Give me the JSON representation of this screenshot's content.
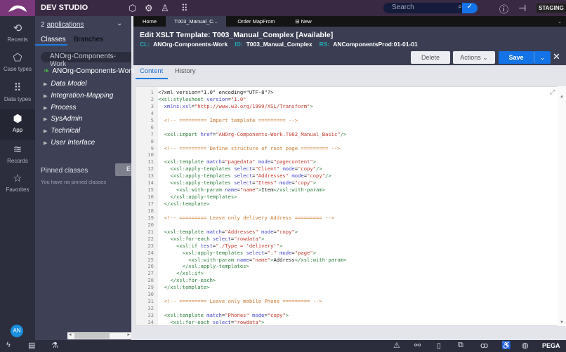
{
  "topbar": {
    "studio": "DEV STUDIO",
    "search_placeholder": "Search",
    "env": "STAGING",
    "icons": [
      "cube-icon",
      "gear-icon",
      "rocket-icon",
      "grid-icon"
    ]
  },
  "rail": [
    {
      "label": "Recents",
      "icon": "⟲"
    },
    {
      "label": "Case types",
      "icon": "⬠"
    },
    {
      "label": "Data types",
      "icon": "⠿"
    },
    {
      "label": "App",
      "icon": "⬢"
    },
    {
      "label": "Records",
      "icon": "≋"
    },
    {
      "label": "Favorites",
      "icon": "☆"
    }
  ],
  "user": {
    "initials": "AN"
  },
  "sidebar": {
    "app_count": "2",
    "apps_link": "applications",
    "tabs": [
      "Classes",
      "Branches"
    ],
    "class_field": "ANOrg-Components-Work",
    "root": "ANOrg-Components-Work",
    "nodes": [
      "Data Model",
      "Integration-Mapping",
      "Process",
      "SysAdmin",
      "Technical",
      "User Interface"
    ],
    "pinned_title": "Pinned classes",
    "pinned_empty": "You have no pinned classes",
    "pinned_btn": "E"
  },
  "tabs": [
    "Home",
    "T003_Manual_C...",
    "Order MapFrom",
    "New"
  ],
  "header": {
    "title": "Edit  XSLT Template: T003_Manual_Complex [Available]",
    "cl_key": "CL:",
    "cl": "ANOrg-Components-Work",
    "id_key": "ID:",
    "id": "T003_Manual_Complex",
    "rs_key": "RS:",
    "rs": "ANComponentsProd:01-01-01",
    "delete": "Delete",
    "actions": "Actions",
    "save": "Save"
  },
  "content_tabs": [
    "Content",
    "History"
  ],
  "code": [
    [
      [
        "txt",
        "<?xml version=\"1.0\" encoding=\"UTF-8\"?>"
      ]
    ],
    [
      [
        "tag",
        "<xsl:stylesheet "
      ],
      [
        "attr",
        "version"
      ],
      [
        "txt",
        "="
      ],
      [
        "str",
        "\"1.0\""
      ]
    ],
    [
      [
        "txt",
        "  "
      ],
      [
        "attr",
        "xmlns:xsl"
      ],
      [
        "txt",
        "="
      ],
      [
        "str",
        "\"http://www.w3.org/1999/XSL/Transform\""
      ],
      [
        "tag",
        ">"
      ]
    ],
    [],
    [
      [
        "com",
        "  <!-- ========= Import template ========= -->"
      ]
    ],
    [],
    [
      [
        "tag",
        "  <xsl:import "
      ],
      [
        "attr",
        "href"
      ],
      [
        "txt",
        "="
      ],
      [
        "str",
        "\"ANOrg-Components-Work.T002_Manual_Basic\""
      ],
      [
        "tag",
        "/>"
      ]
    ],
    [],
    [
      [
        "com",
        "  <!-- ========= Define structure of root page ========= -->"
      ]
    ],
    [],
    [
      [
        "tag",
        "  <xsl:template "
      ],
      [
        "attr",
        "match"
      ],
      [
        "txt",
        "="
      ],
      [
        "str",
        "\"pagedata\" "
      ],
      [
        "attr",
        "mode"
      ],
      [
        "txt",
        "="
      ],
      [
        "str",
        "\"pagecontent\""
      ],
      [
        "tag",
        ">"
      ]
    ],
    [
      [
        "tag",
        "    <xsl:apply-templates "
      ],
      [
        "attr",
        "select"
      ],
      [
        "txt",
        "="
      ],
      [
        "str",
        "\"Client\" "
      ],
      [
        "attr",
        "mode"
      ],
      [
        "txt",
        "="
      ],
      [
        "str",
        "\"copy\""
      ],
      [
        "tag",
        "/>"
      ]
    ],
    [
      [
        "tag",
        "    <xsl:apply-templates "
      ],
      [
        "attr",
        "select"
      ],
      [
        "txt",
        "="
      ],
      [
        "str",
        "\"Addresses\" "
      ],
      [
        "attr",
        "mode"
      ],
      [
        "txt",
        "="
      ],
      [
        "str",
        "\"copy\""
      ],
      [
        "tag",
        "/>"
      ]
    ],
    [
      [
        "tag",
        "    <xsl:apply-templates "
      ],
      [
        "attr",
        "select"
      ],
      [
        "txt",
        "="
      ],
      [
        "str",
        "\"Items\" "
      ],
      [
        "attr",
        "mode"
      ],
      [
        "txt",
        "="
      ],
      [
        "str",
        "\"copy\""
      ],
      [
        "tag",
        ">"
      ]
    ],
    [
      [
        "tag",
        "      <xsl:with-param "
      ],
      [
        "attr",
        "name"
      ],
      [
        "txt",
        "="
      ],
      [
        "str",
        "\"name\""
      ],
      [
        "tag",
        ">"
      ],
      [
        "txt",
        "Item"
      ],
      [
        "tag",
        "</xsl:with-param>"
      ]
    ],
    [
      [
        "tag",
        "    </xsl:apply-templates>"
      ]
    ],
    [
      [
        "tag",
        "  </xsl:template>"
      ]
    ],
    [],
    [
      [
        "com",
        "  <!-- ========= Leave only delivery Address ========= -->"
      ]
    ],
    [],
    [
      [
        "tag",
        "  <xsl:template "
      ],
      [
        "attr",
        "match"
      ],
      [
        "txt",
        "="
      ],
      [
        "str",
        "\"Addresses\" "
      ],
      [
        "attr",
        "mode"
      ],
      [
        "txt",
        "="
      ],
      [
        "str",
        "\"copy\""
      ],
      [
        "tag",
        ">"
      ]
    ],
    [
      [
        "tag",
        "    <xsl:for-each "
      ],
      [
        "attr",
        "select"
      ],
      [
        "txt",
        "="
      ],
      [
        "str",
        "\"rowdata\""
      ],
      [
        "tag",
        ">"
      ]
    ],
    [
      [
        "tag",
        "      <xsl:if "
      ],
      [
        "attr",
        "test"
      ],
      [
        "txt",
        "="
      ],
      [
        "str",
        "\"./Type = 'delivery'\""
      ],
      [
        "tag",
        ">"
      ]
    ],
    [
      [
        "tag",
        "        <xsl:apply-templates "
      ],
      [
        "attr",
        "select"
      ],
      [
        "txt",
        "="
      ],
      [
        "str",
        "\".\" "
      ],
      [
        "attr",
        "mode"
      ],
      [
        "txt",
        "="
      ],
      [
        "str",
        "\"page\""
      ],
      [
        "tag",
        ">"
      ]
    ],
    [
      [
        "tag",
        "          <xsl:with-param "
      ],
      [
        "attr",
        "name"
      ],
      [
        "txt",
        "="
      ],
      [
        "str",
        "\"name\""
      ],
      [
        "tag",
        ">"
      ],
      [
        "txt",
        "Address"
      ],
      [
        "tag",
        "</xsl:with-param>"
      ]
    ],
    [
      [
        "tag",
        "        </xsl:apply-templates>"
      ]
    ],
    [
      [
        "tag",
        "      </xsl:if>"
      ]
    ],
    [
      [
        "tag",
        "    </xsl:for-each>"
      ]
    ],
    [
      [
        "tag",
        "  </xsl:template>"
      ]
    ],
    [],
    [
      [
        "com",
        "  <!-- ========= Leave only mobile Phone ========= -->"
      ]
    ],
    [],
    [
      [
        "tag",
        "  <xsl:template "
      ],
      [
        "attr",
        "match"
      ],
      [
        "txt",
        "="
      ],
      [
        "str",
        "\"Phones\" "
      ],
      [
        "attr",
        "mode"
      ],
      [
        "txt",
        "="
      ],
      [
        "str",
        "\"copy\""
      ],
      [
        "tag",
        ">"
      ]
    ],
    [
      [
        "tag",
        "    <xsl:for-each "
      ],
      [
        "attr",
        "select"
      ],
      [
        "txt",
        "="
      ],
      [
        "str",
        "\"rowdata\""
      ],
      [
        "tag",
        ">"
      ]
    ]
  ],
  "footer": {
    "brand": "PEGA"
  }
}
